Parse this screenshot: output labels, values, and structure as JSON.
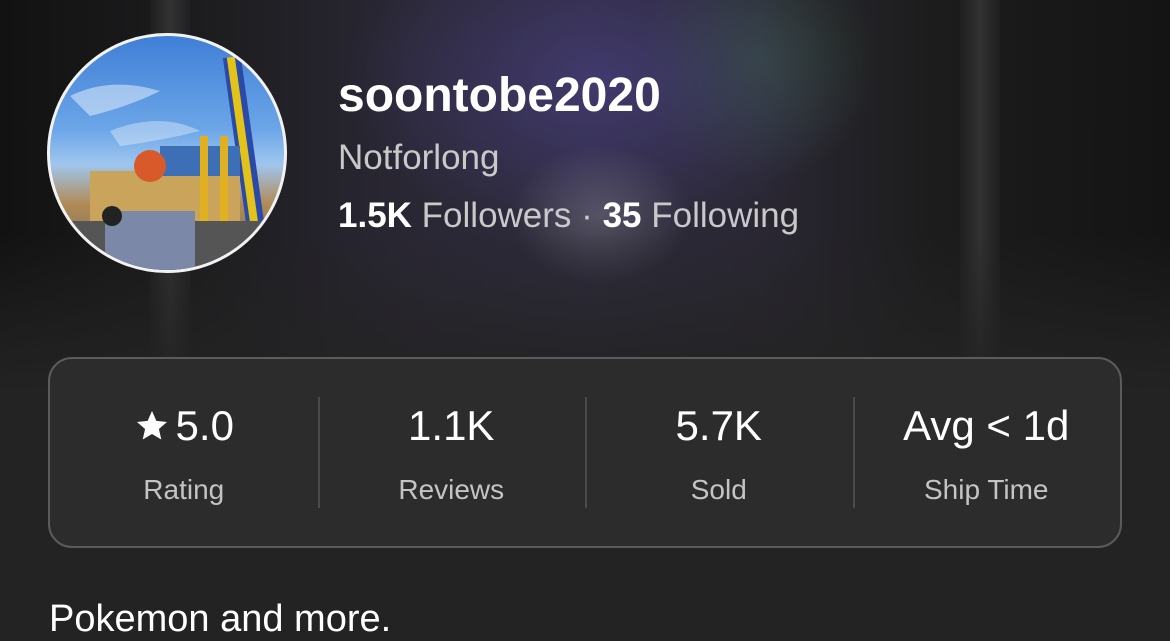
{
  "profile": {
    "username": "soontobe2020",
    "display_name": "Notforlong",
    "followers_count": "1.5K",
    "followers_label": "Followers",
    "separator": "·",
    "following_count": "35",
    "following_label": "Following",
    "bio": "Pokemon and more."
  },
  "stats": [
    {
      "icon": "star-icon",
      "value": "5.0",
      "label": "Rating"
    },
    {
      "value": "1.1K",
      "label": "Reviews"
    },
    {
      "value": "5.7K",
      "label": "Sold"
    },
    {
      "value": "Avg < 1d",
      "label": "Ship Time"
    }
  ],
  "colors": {
    "background": "#232323",
    "card": "#2c2c2c",
    "card_border": "#5b5b5b",
    "text_primary": "#ffffff",
    "text_secondary": "#c4c4c4"
  }
}
